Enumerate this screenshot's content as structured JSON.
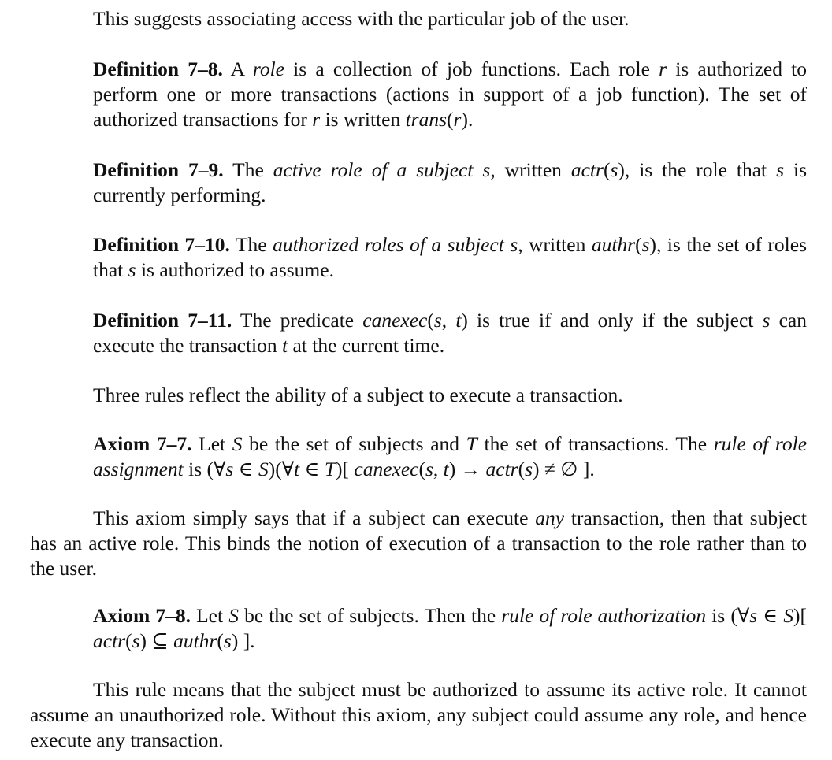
{
  "paragraphs": {
    "intro": {
      "text": "This suggests associating access with the particular job of the user."
    },
    "def_7_8": {
      "label": "Definition 7–8.",
      "t1": " A ",
      "i1": "role",
      "t2": " is a collection of job functions. Each role ",
      "i2": "r",
      "t3": " is authorized to perform one or more transactions (actions in support of a job function). The set of authorized transactions for ",
      "i3": "r",
      "t4": " is written ",
      "i4": "trans",
      "t5": "(",
      "i5": "r",
      "t6": ")."
    },
    "def_7_9": {
      "label": "Definition 7–9.",
      "t1": " The ",
      "i1": "active role of a subject s",
      "t2": ", written ",
      "i2": "actr",
      "t3": "(",
      "i3": "s",
      "t4": "), is the role that ",
      "i4": "s",
      "t5": " is currently performing."
    },
    "def_7_10": {
      "label": "Definition 7–10.",
      "t1": " The ",
      "i1": "authorized roles of a subject s",
      "t2": ", written ",
      "i2": "authr",
      "t3": "(",
      "i3": "s",
      "t4": "), is the set of roles that ",
      "i4": "s",
      "t5": " is authorized to assume."
    },
    "def_7_11": {
      "label": "Definition 7–11.",
      "t1": " The predicate ",
      "i1": "canexec",
      "t2": "(",
      "i2": "s",
      "t3": ", ",
      "i3": "t",
      "t4": ") is true if and only if the subject ",
      "i4": "s",
      "t5": " can execute the transaction ",
      "i5": "t",
      "t6": " at the current time."
    },
    "three_rules": {
      "text": "Three rules reflect the ability of a subject to execute a transaction."
    },
    "axiom_7_7": {
      "label": "Axiom 7–7.",
      "t1": " Let ",
      "i1": "S",
      "t2": " be the set of subjects and ",
      "i2": "T",
      "t3": " the set of transactions. The ",
      "i3": "rule of role assignment",
      "t4": " is (∀",
      "i4": "s",
      "t5": " ∈ ",
      "i5": "S",
      "t6": ")(∀",
      "i6": "t",
      "t7": " ∈ ",
      "i7": "T",
      "t8": ")[ ",
      "i8": "canexec",
      "t9": "(",
      "i9": "s",
      "t10": ", ",
      "i10": "t",
      "t11": ") → ",
      "i11": "actr",
      "t12": "(",
      "i12": "s",
      "t13": ") ≠ ∅ ]."
    },
    "axiom_7_7_explain": {
      "t1": "This axiom simply says that if a subject can execute ",
      "i1": "any",
      "t2": " transaction, then that subject has an active role. This binds the notion of execution of a transaction to the role rather than to the user."
    },
    "axiom_7_8": {
      "label": "Axiom 7–8.",
      "t1": " Let ",
      "i1": "S",
      "t2": " be the set of subjects. Then the ",
      "i2": "rule of role authorization",
      "t3": " is (∀",
      "i3": "s",
      "t4": " ∈ ",
      "i4": "S",
      "t5": ")[ ",
      "i5": "actr",
      "t6": "(",
      "i6": "s",
      "t7": ") ⊆ ",
      "i7": "authr",
      "t8": "(",
      "i8": "s",
      "t9": ") ]."
    },
    "axiom_7_8_explain": {
      "text": "This rule means that the subject must be authorized to assume its active role. It cannot assume an unauthorized role. Without this axiom, any subject could assume any role, and hence execute any transaction."
    }
  }
}
